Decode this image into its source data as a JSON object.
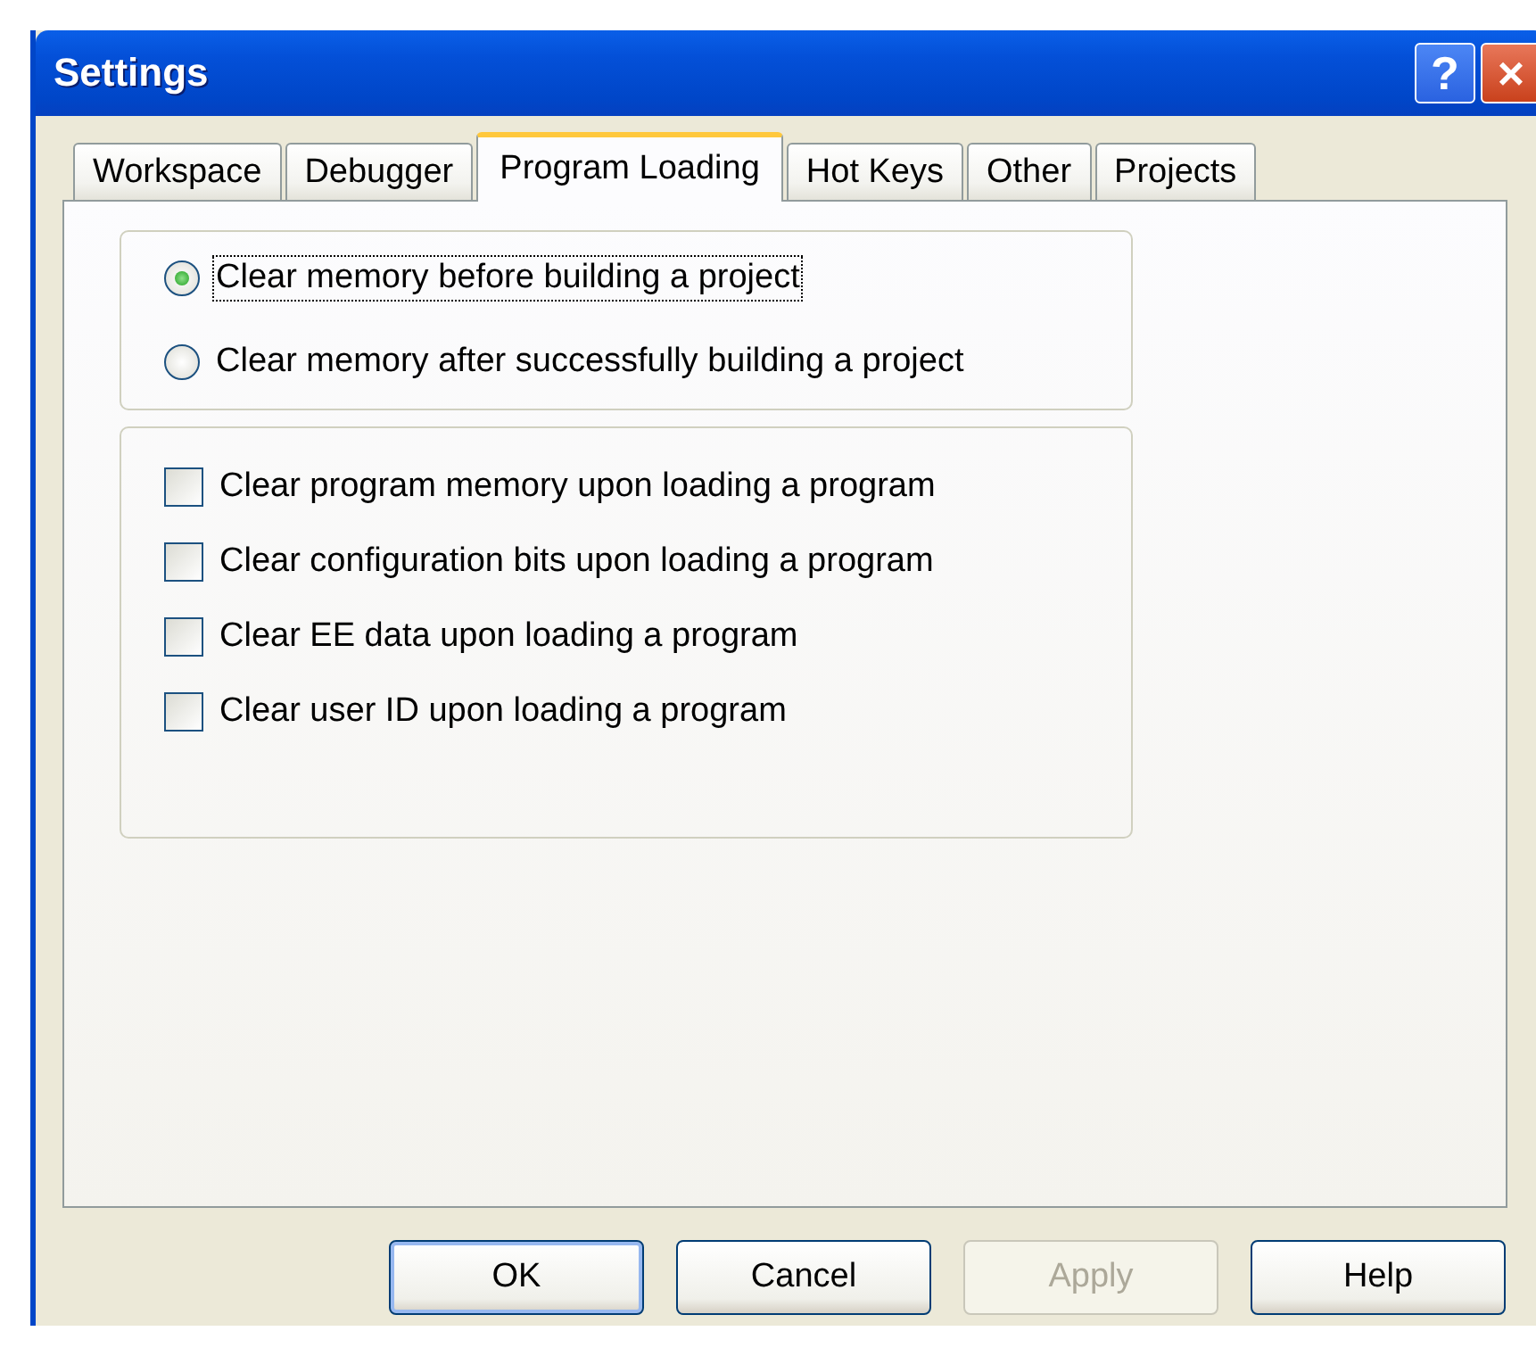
{
  "window": {
    "title": "Settings",
    "title_buttons": [
      {
        "kind": "help",
        "label": "?"
      },
      {
        "kind": "close",
        "label": "×"
      }
    ]
  },
  "tabs": [
    {
      "label": "Workspace",
      "selected": false
    },
    {
      "label": "Debugger",
      "selected": false
    },
    {
      "label": "Program Loading",
      "selected": true
    },
    {
      "label": "Hot Keys",
      "selected": false
    },
    {
      "label": "Other",
      "selected": false
    },
    {
      "label": "Projects",
      "selected": false
    }
  ],
  "radio_options": [
    {
      "label": "Clear memory before building a project",
      "selected": true
    },
    {
      "label": "Clear memory after successfully building a project",
      "selected": false
    }
  ],
  "checkboxes": [
    {
      "label": "Clear program memory upon loading a program",
      "checked": false
    },
    {
      "label": "Clear configuration bits upon loading a program",
      "checked": false
    },
    {
      "label": "Clear EE data upon loading a program",
      "checked": false
    },
    {
      "label": "Clear user ID upon loading a program",
      "checked": false
    }
  ],
  "buttons": [
    {
      "label": "OK",
      "disabled": false,
      "default": true
    },
    {
      "label": "Cancel",
      "disabled": false,
      "default": false
    },
    {
      "label": "Apply",
      "disabled": true,
      "default": false
    },
    {
      "label": "Help",
      "disabled": false,
      "default": false
    }
  ]
}
